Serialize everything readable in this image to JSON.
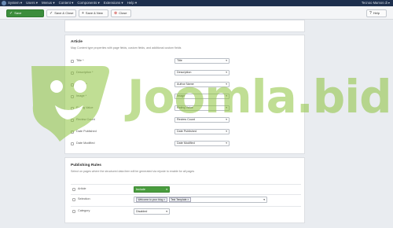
{
  "topnav": {
    "menu": [
      "System ▾",
      "Users ▾",
      "Menus ▾",
      "Content ▾",
      "Components ▾",
      "Extensions ▾",
      "Help ▾"
    ],
    "right": "Tecnoo Mamos di ▾"
  },
  "toolbar": {
    "save": "Save",
    "save_close": "Save & Close",
    "save_new": "Save & New",
    "close": "Close",
    "help": "Help"
  },
  "article": {
    "title": "Article",
    "desc": "Map Content type properties with page fields, custom fields, and additional custom fields",
    "fields": [
      {
        "label": "Title *",
        "value": "Title"
      },
      {
        "label": "Description *",
        "value": "Description"
      },
      {
        "label": "Author *",
        "value": "Author Name"
      },
      {
        "label": "Image *",
        "value": "Image"
      },
      {
        "label": "Rating Value",
        "value": "Rating Value"
      },
      {
        "label": "Review Count",
        "value": "Review Count"
      },
      {
        "label": "Date Published",
        "value": "Date Published"
      },
      {
        "label": "Date Modified",
        "value": "Date Modified"
      }
    ]
  },
  "publishing": {
    "title": "Publishing Rules",
    "desc": "Select on pages where the structured data item will be generated via rejuste to enable for all pages",
    "rows": {
      "article_label": "Article",
      "article_value": "Include",
      "selection_label": "Selection",
      "selection_tags": [
        "Welcome to your blog ×",
        "Test Template ×"
      ],
      "category_label": "Category",
      "category_value": "Disabled"
    }
  },
  "watermark": {
    "text": "Joomla.bid"
  },
  "colors": {
    "nav": "#1d2f4d",
    "save_button": "#3c8d3c",
    "include_green": "#4a9d3f",
    "watermark_green": "#8cc33c"
  }
}
